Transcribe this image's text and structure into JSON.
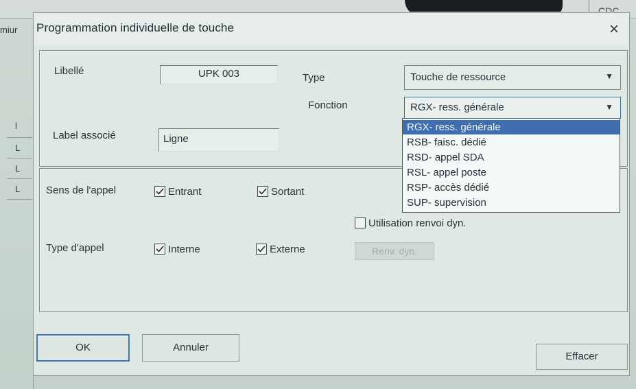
{
  "background": {
    "left_truncated_text": "miur",
    "right_truncated_text": "CDC",
    "left_rows": [
      "l",
      "L",
      "L",
      "L"
    ]
  },
  "dialog": {
    "title": "Programmation individuelle de touche",
    "close_icon": "close-icon"
  },
  "identity": {
    "libelle_label": "Libellé",
    "libelle_value": "UPK 003",
    "label_associe_label": "Label associé",
    "label_associe_value": "Ligne",
    "type_label": "Type",
    "type_value": "Touche de ressource",
    "fonction_label": "Fonction",
    "fonction_value": "RGX- ress. générale",
    "fonction_options": [
      "RGX- ress. générale",
      "RSB- faisc. dédié",
      "RSD- appel SDA",
      "RSL- appel poste",
      "RSP- accès dédié",
      "SUP- supervision"
    ],
    "fonction_selected_index": 0
  },
  "call": {
    "sens_label": "Sens de l'appel",
    "entrant_label": "Entrant",
    "entrant_checked": true,
    "sortant_label": "Sortant",
    "sortant_checked": true,
    "type_label": "Type d'appel",
    "interne_label": "Interne",
    "interne_checked": true,
    "externe_label": "Externe",
    "externe_checked": true,
    "renvoi_label": "Utilisation renvoi dyn.",
    "renvoi_checked": false,
    "renv_button": "Renv. dyn."
  },
  "buttons": {
    "ok": "OK",
    "annuler": "Annuler",
    "effacer": "Effacer"
  },
  "colors": {
    "accent": "#3f6fb0",
    "dialog_bg": "#dfe8e2"
  }
}
